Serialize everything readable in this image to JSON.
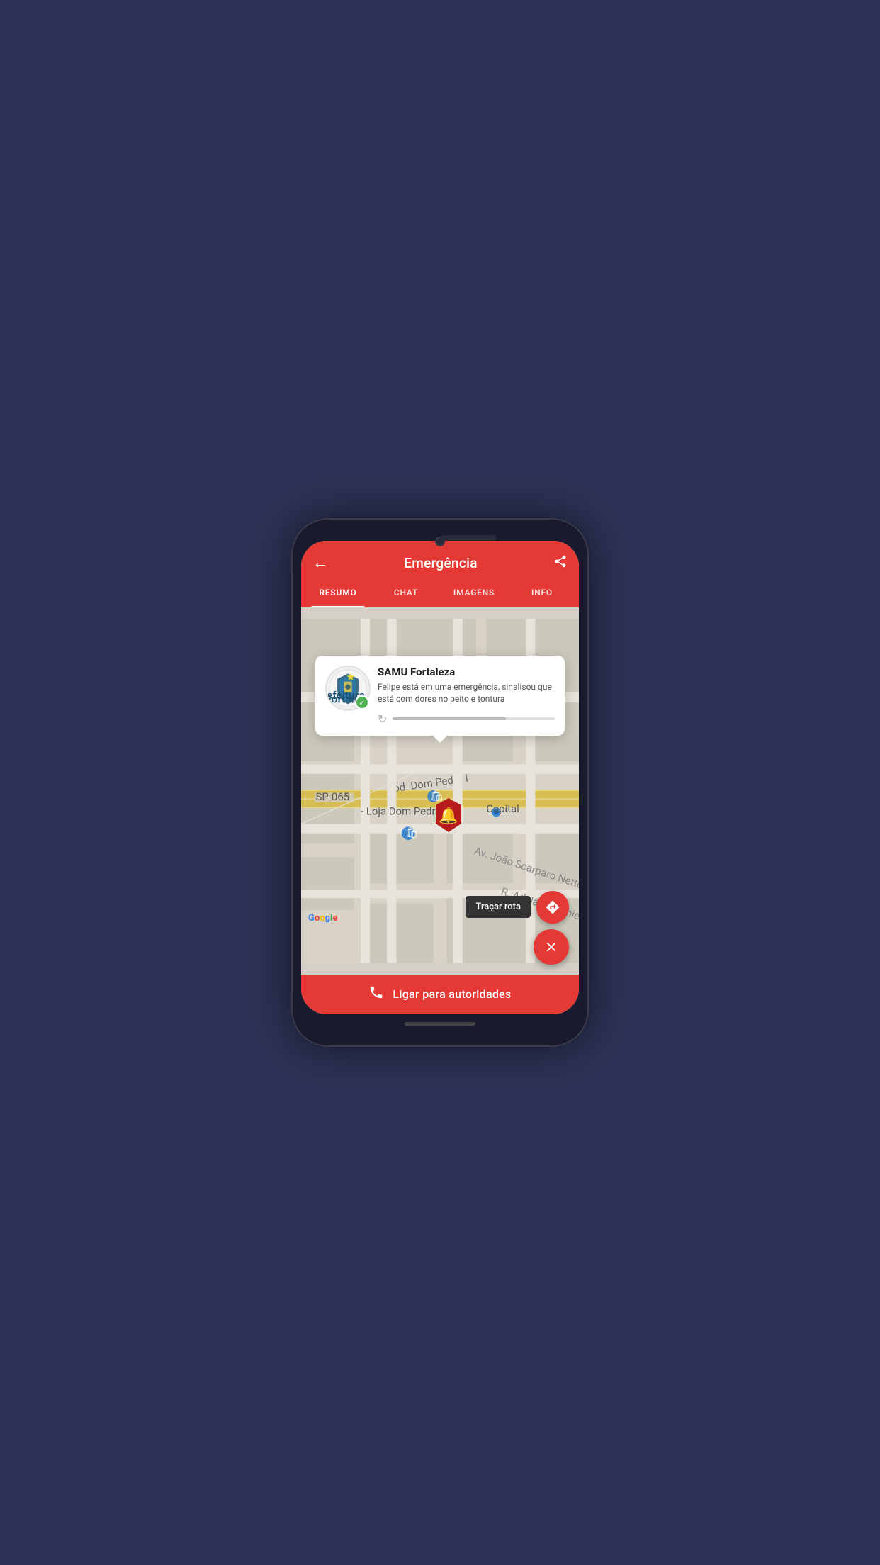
{
  "header": {
    "title": "Emergência",
    "back_label": "←",
    "share_label": "⋮"
  },
  "tabs": [
    {
      "id": "resumo",
      "label": "RESUMO",
      "active": true
    },
    {
      "id": "chat",
      "label": "CHAT",
      "active": false
    },
    {
      "id": "imagens",
      "label": "IMAGENS",
      "active": false
    },
    {
      "id": "info",
      "label": "INFO",
      "active": false
    }
  ],
  "popup": {
    "title": "SAMU Fortaleza",
    "description": "Felipe está em uma emergência, sinalisou que está com dores no peito e tontura",
    "check_icon": "✓",
    "progress_percent": 70
  },
  "map": {
    "route_label": "Traçar rota",
    "google_label": "Google"
  },
  "bottom_bar": {
    "call_label": "Ligar para autoridades",
    "call_icon": "📞"
  },
  "colors": {
    "primary": "#e53935",
    "map_bg": "#d4d0c8",
    "road_yellow": "#d4b94a",
    "road_white": "#ffffff",
    "pin_red": "#b71c1c"
  }
}
